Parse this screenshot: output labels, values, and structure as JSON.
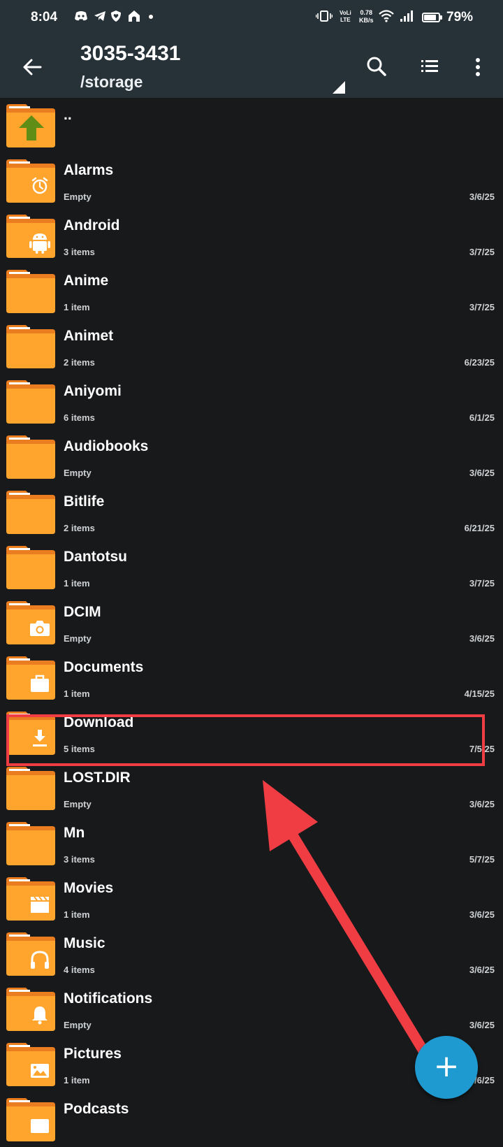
{
  "status_bar": {
    "time": "8:04",
    "net_speed_value": "0.78",
    "net_speed_unit": "KB/s",
    "volte_top": "VoLi",
    "volte_bottom": "LTE",
    "battery_level": 0.79,
    "battery_percent": "79%",
    "notification_icons": [
      "discord-icon",
      "telegram-icon",
      "shield-heart-icon",
      "home-icon",
      "dot-icon"
    ]
  },
  "toolbar": {
    "title": "3035-3431",
    "path": "/storage"
  },
  "parent_item": {
    "name": ".."
  },
  "items": [
    {
      "name": "Alarms",
      "count": "Empty",
      "date": "3/6/25",
      "icon": "alarm-icon"
    },
    {
      "name": "Android",
      "count": "3 items",
      "date": "3/7/25",
      "icon": "android-icon"
    },
    {
      "name": "Anime",
      "count": "1 item",
      "date": "3/7/25",
      "icon": ""
    },
    {
      "name": "Animet",
      "count": "2 items",
      "date": "6/23/25",
      "icon": ""
    },
    {
      "name": "Aniyomi",
      "count": "6 items",
      "date": "6/1/25",
      "icon": ""
    },
    {
      "name": "Audiobooks",
      "count": "Empty",
      "date": "3/6/25",
      "icon": ""
    },
    {
      "name": "Bitlife",
      "count": "2 items",
      "date": "6/21/25",
      "icon": ""
    },
    {
      "name": "Dantotsu",
      "count": "1 item",
      "date": "3/7/25",
      "icon": ""
    },
    {
      "name": "DCIM",
      "count": "Empty",
      "date": "3/6/25",
      "icon": "camera-icon"
    },
    {
      "name": "Documents",
      "count": "1 item",
      "date": "4/15/25",
      "icon": "briefcase-icon"
    },
    {
      "name": "Download",
      "count": "5 items",
      "date": "7/5/25",
      "icon": "download-icon"
    },
    {
      "name": "LOST.DIR",
      "count": "Empty",
      "date": "3/6/25",
      "icon": ""
    },
    {
      "name": "Mn",
      "count": "3 items",
      "date": "5/7/25",
      "icon": ""
    },
    {
      "name": "Movies",
      "count": "1 item",
      "date": "3/6/25",
      "icon": "clapperboard-icon"
    },
    {
      "name": "Music",
      "count": "4 items",
      "date": "3/6/25",
      "icon": "headphones-icon"
    },
    {
      "name": "Notifications",
      "count": "Empty",
      "date": "3/6/25",
      "icon": "bell-icon"
    },
    {
      "name": "Pictures",
      "count": "1 item",
      "date": "3/6/25",
      "icon": "image-icon"
    },
    {
      "name": "Podcasts",
      "count": "",
      "date": "",
      "icon": "podcast-icon"
    }
  ],
  "fab": {
    "label": "+"
  },
  "colors": {
    "bar": "#263238",
    "background": "#18191b",
    "folder": "#ffa52d",
    "folder_tab": "#ea7d1f",
    "highlight": "#f03d44",
    "fab": "#1e9ad1"
  }
}
